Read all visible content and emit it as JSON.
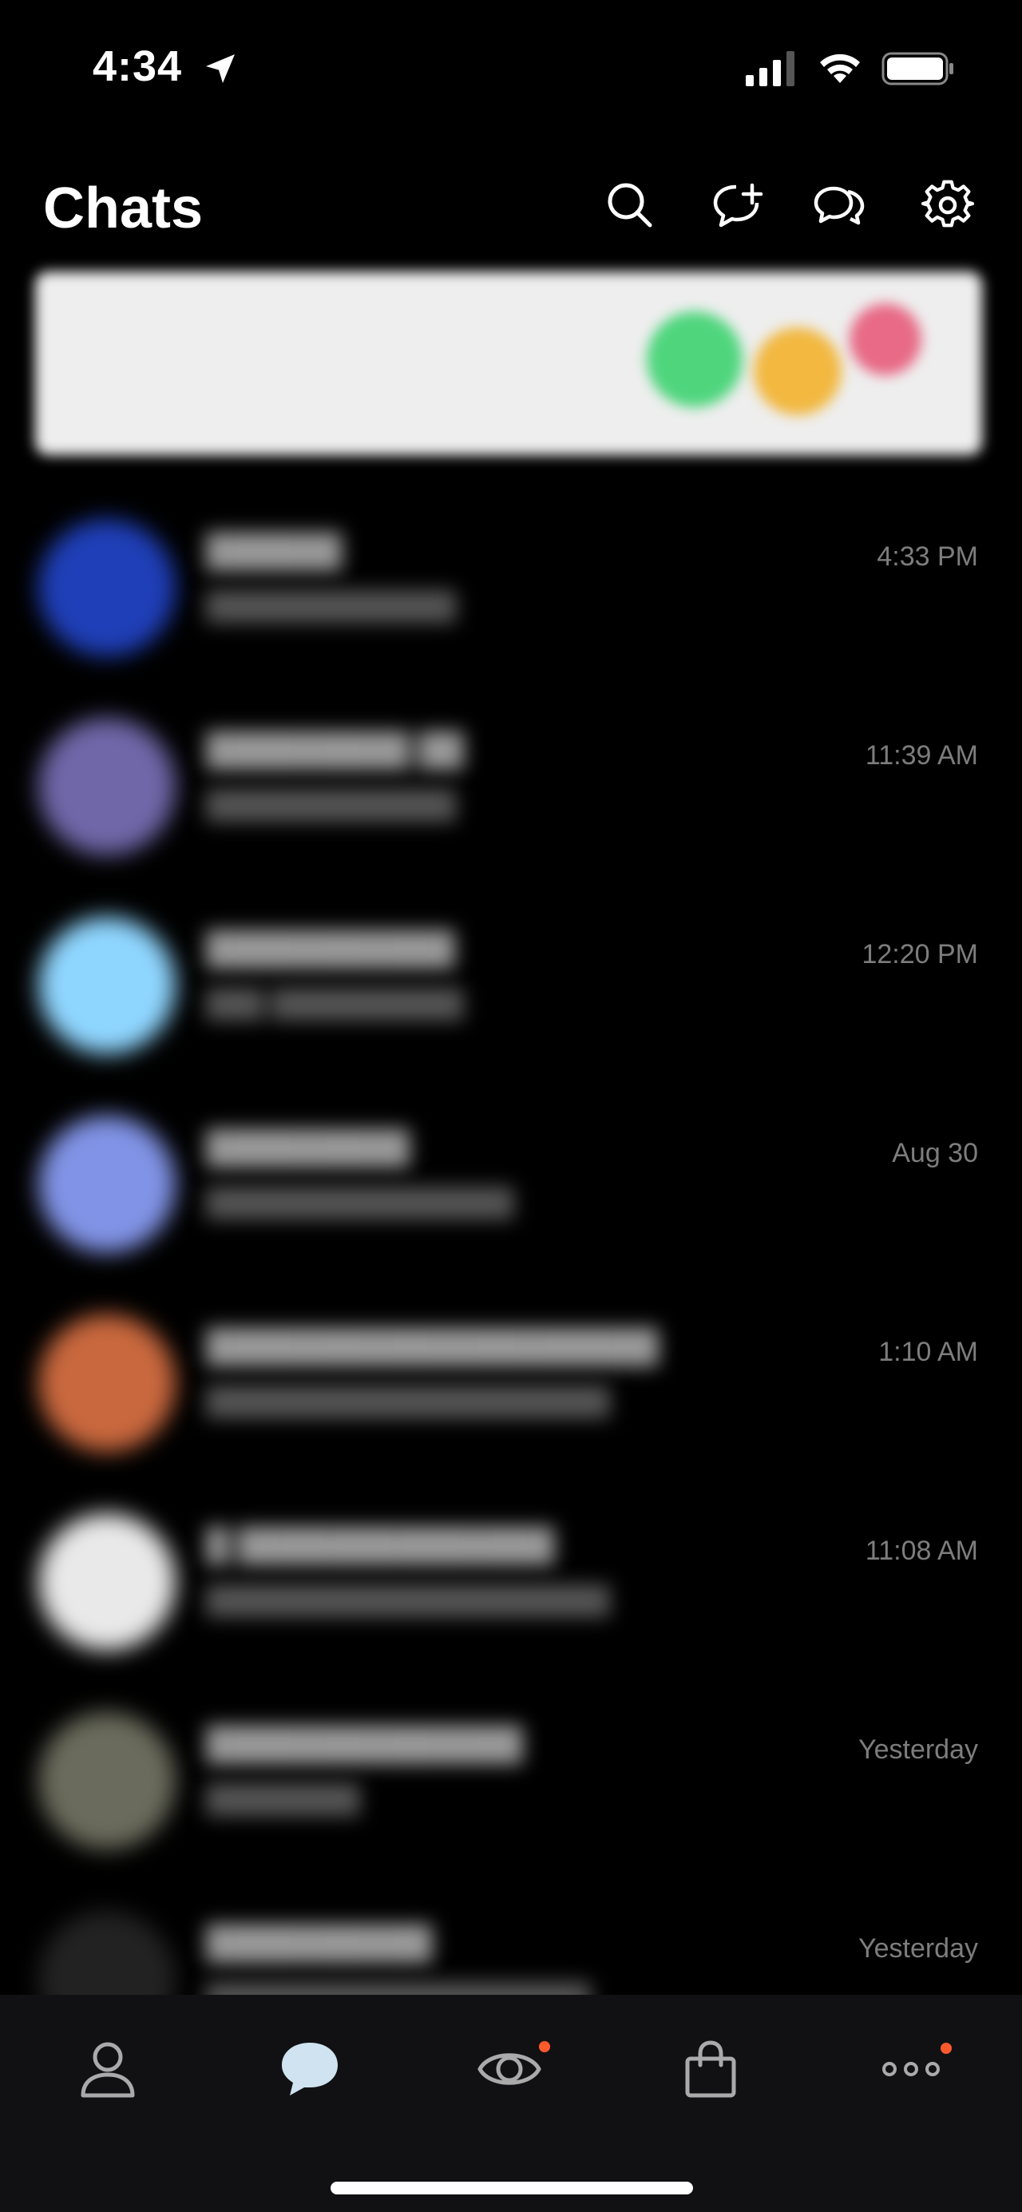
{
  "status_bar": {
    "time": "4:34",
    "icons": [
      "location-arrow-icon",
      "cellular-signal-icon",
      "wifi-icon",
      "battery-icon"
    ]
  },
  "header": {
    "title": "Chats",
    "actions": [
      "search-icon",
      "new-chat-icon",
      "open-chats-icon",
      "settings-icon"
    ]
  },
  "banner": {
    "headline": "",
    "subtitle": ""
  },
  "chats": [
    {
      "time": "4:33 PM",
      "avatar_color": "#1f3fb8"
    },
    {
      "time": "11:39 AM",
      "avatar_color": "#6f67a8"
    },
    {
      "time": "12:20 PM",
      "avatar_color": "#8fd6ff"
    },
    {
      "time": "Aug 30",
      "avatar_color": "#8193e6"
    },
    {
      "time": "1:10 AM",
      "avatar_color": "#c9683e"
    },
    {
      "time": "11:08 AM",
      "avatar_color": "#e9e9e9"
    },
    {
      "time": "Yesterday",
      "avatar_color": "#6a6b5c"
    },
    {
      "time": "Yesterday",
      "avatar_color": "#222222"
    }
  ],
  "tab_bar": {
    "tabs": [
      {
        "icon": "friends-icon",
        "badge": false
      },
      {
        "icon": "chats-icon",
        "badge": false,
        "active": true
      },
      {
        "icon": "view-icon",
        "badge": true
      },
      {
        "icon": "shopping-icon",
        "badge": false
      },
      {
        "icon": "more-icon",
        "badge": true
      }
    ]
  },
  "colors": {
    "background": "#000000",
    "tab_bar_background": "#111114",
    "time_text": "#7d7d7d",
    "badge": "#ff5a2c"
  }
}
